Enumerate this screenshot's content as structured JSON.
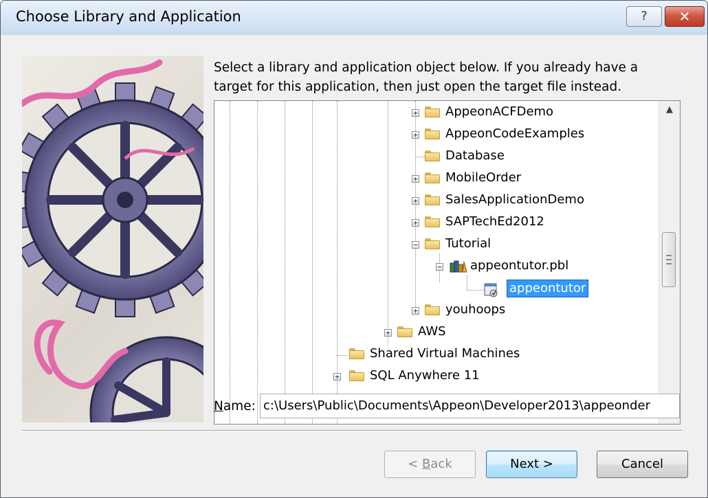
{
  "window": {
    "title": "Choose Library and Application",
    "help_label": "?",
    "close_label": "✕"
  },
  "instructions": {
    "line1": "Select a library and application object below.  If you already have a",
    "line2": "target for this application, then just open the target file instead."
  },
  "tree": {
    "items": [
      {
        "label": "AppeonACFDemo",
        "icon": "folder-icon",
        "expander": "+"
      },
      {
        "label": "AppeonCodeExamples",
        "icon": "folder-icon",
        "expander": "+"
      },
      {
        "label": "Database",
        "icon": "folder-icon",
        "expander": ""
      },
      {
        "label": "MobileOrder",
        "icon": "folder-icon",
        "expander": "+"
      },
      {
        "label": "SalesApplicationDemo",
        "icon": "folder-icon",
        "expander": "+"
      },
      {
        "label": "SAPTechEd2012",
        "icon": "folder-icon",
        "expander": "+"
      },
      {
        "label": "Tutorial",
        "icon": "folder-icon",
        "expander": "−"
      },
      {
        "label": "appeontutor.pbl",
        "icon": "library-icon",
        "expander": "−"
      },
      {
        "label": "appeontutor",
        "icon": "application-icon",
        "expander": "",
        "selected": true
      },
      {
        "label": "youhoops",
        "icon": "folder-icon",
        "expander": "+"
      },
      {
        "label": "AWS",
        "icon": "folder-icon",
        "expander": "+"
      },
      {
        "label": "Shared Virtual Machines",
        "icon": "folder-icon",
        "expander": ""
      },
      {
        "label": "SQL Anywhere 11",
        "icon": "folder-icon",
        "expander": "+"
      }
    ]
  },
  "name_field": {
    "label": "Name:",
    "label_mnemonic": "N",
    "label_rest": "ame:",
    "value": "c:\\Users\\Public\\Documents\\Appeon\\Developer2013\\appeonder"
  },
  "buttons": {
    "back": "< Back",
    "back_mnemonic": "B",
    "next": "Next >",
    "cancel": "Cancel"
  }
}
